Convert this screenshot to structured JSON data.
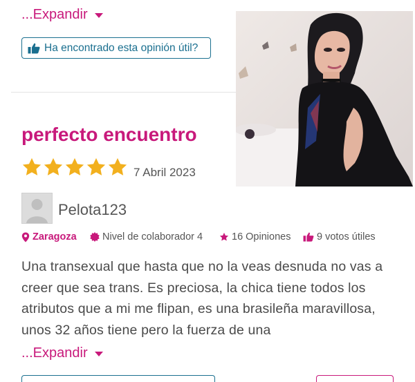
{
  "top_review": {
    "expand_label": "...Expandir",
    "helpful_label": "Ha encontrado esta opinión útil?"
  },
  "review": {
    "title": "perfecto encuentro",
    "rating": 5,
    "date": "7 Abril 2023",
    "username": "Pelota123",
    "city": "Zaragoza",
    "level": "Nivel de colaborador 4",
    "opinions": "16 Opiniones",
    "useful_votes": "9 votos útiles",
    "text": "Una transexual que hasta que no la veas desnuda no vas a creer que sea trans. Es preciosa, la chica tiene todos los atributos que a mi me flipan, es una brasileña maravillosa, unos 32 años tiene pero la fuerza de una",
    "expand_label": "...Expandir"
  },
  "colors": {
    "accent": "#c8197b",
    "button_border": "#1a6f8f",
    "star": "#f2b01e"
  },
  "icons": [
    "caret-down-icon",
    "thumbs-up-icon",
    "location-pin-icon",
    "badge-icon",
    "star-icon"
  ]
}
